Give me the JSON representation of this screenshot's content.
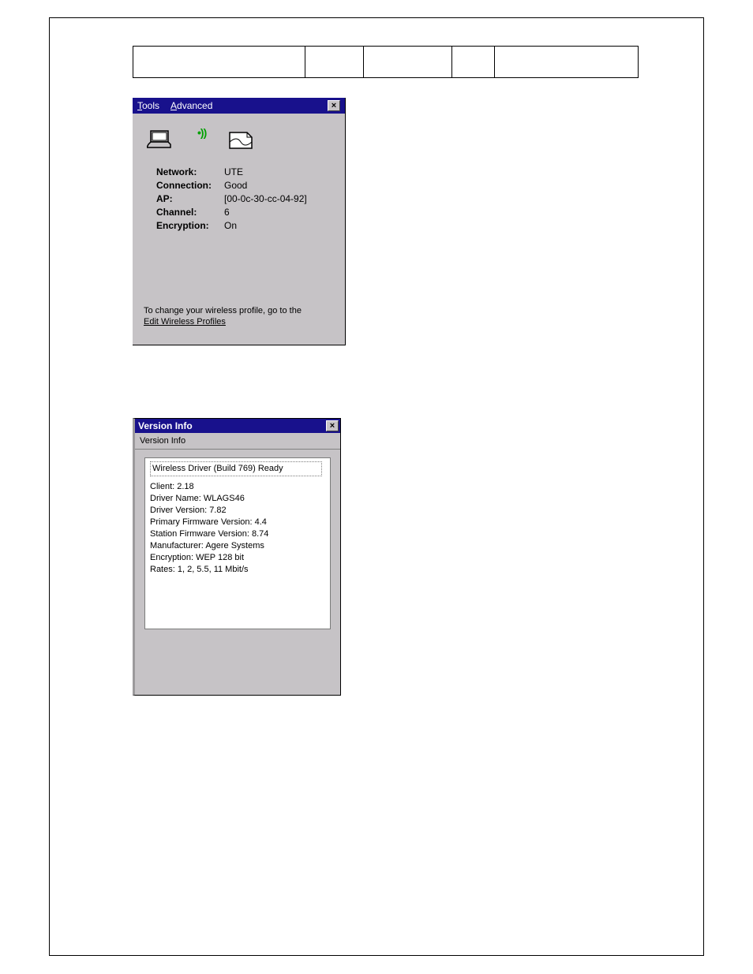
{
  "win1": {
    "menu_tools": "Tools",
    "menu_advanced": "Advanced",
    "close": "×",
    "fields": {
      "network_label": "Network:",
      "network_value": "UTE",
      "connection_label": "Connection:",
      "connection_value": "Good",
      "ap_label": "AP:",
      "ap_value": "[00-0c-30-cc-04-92]",
      "channel_label": "Channel:",
      "channel_value": "6",
      "encryption_label": "Encryption:",
      "encryption_value": "On"
    },
    "footer_line1": "To change your wireless profile, go to the",
    "footer_link": "Edit Wireless Profiles"
  },
  "win2": {
    "title": "Version Info",
    "subhead": "Version Info",
    "close": "×",
    "status_line": "Wireless Driver (Build 769) Ready",
    "lines": {
      "client": "Client:  2.18",
      "driver_name": "Driver Name:   WLAGS46",
      "driver_version": "Driver Version:  7.82",
      "primary_fw": "Primary Firmware Version:   4.4",
      "station_fw": "Station Firmware Version:  8.74",
      "manufacturer": "Manufacturer:   Agere Systems",
      "encryption": "Encryption:   WEP 128 bit",
      "rates": "Rates:  1, 2, 5.5, 11  Mbit/s"
    }
  }
}
